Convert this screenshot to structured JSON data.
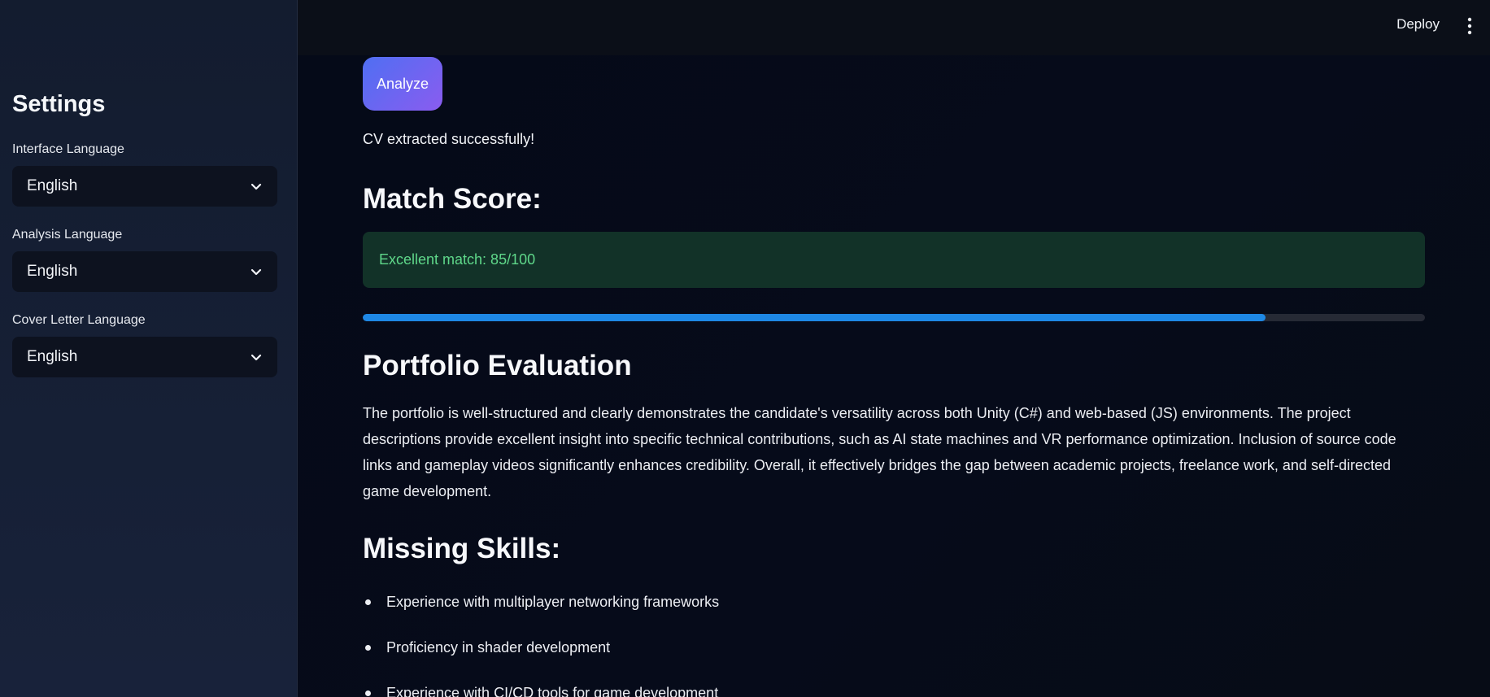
{
  "header": {
    "deploy_label": "Deploy",
    "menu_icon": "vertical-dots-icon"
  },
  "sidebar": {
    "title": "Settings",
    "fields": [
      {
        "label": "Interface Language",
        "value": "English"
      },
      {
        "label": "Analysis Language",
        "value": "English"
      },
      {
        "label": "Cover Letter Language",
        "value": "English"
      }
    ]
  },
  "main": {
    "analyze_label": "Analyze",
    "analyze_gradient": [
      "#4f6ff2",
      "#8a5cf0"
    ],
    "success_message": "CV extracted successfully!",
    "match_heading": "Match Score:",
    "score_message": "Excellent match: 85/100",
    "score_color": "#5fd88a",
    "progress_value": 0.85,
    "progress_color": "#1e88e5",
    "portfolio_heading": "Portfolio Evaluation",
    "portfolio_text": "The portfolio is well-structured and clearly demonstrates the candidate's versatility across both Unity (C#) and web-based (JS) environments. The project descriptions provide excellent insight into specific technical contributions, such as AI state machines and VR performance optimization. Inclusion of source code links and gameplay videos significantly enhances credibility. Overall, it effectively bridges the gap between academic projects, freelance work, and self-directed game development.",
    "missing_heading": "Missing Skills:",
    "missing_skills": [
      "Experience with multiplayer networking frameworks",
      "Proficiency in shader development",
      "Experience with CI/CD tools for game development"
    ]
  }
}
